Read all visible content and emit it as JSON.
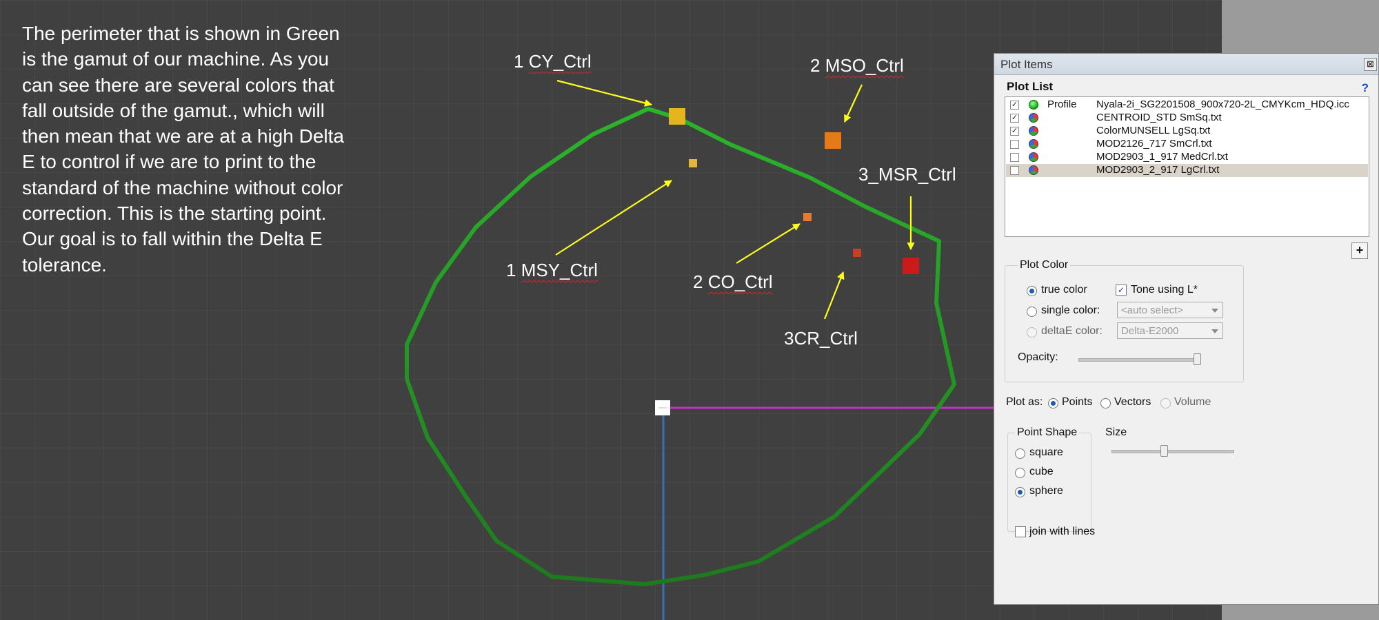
{
  "note": {
    "text": "The perimeter that is shown in Green is the gamut of our machine. As you can see there are several colors that fall outside of the gamut., which will then mean that we are at a high Delta E to control if we are to print to the standard of the machine without color correction. This is the starting point. Our goal is to fall within the Delta E tolerance."
  },
  "callouts": {
    "cy_ctrl": {
      "num": "1 ",
      "word": "CY_Ctrl"
    },
    "mso_ctrl": {
      "num": "2 ",
      "word": "MSO_Ctrl"
    },
    "msr_ctrl": {
      "text": "3_MSR_Ctrl"
    },
    "msy_ctrl": {
      "num": "1 ",
      "word": "MSY_Ctrl"
    },
    "co_ctrl": {
      "num": "2 ",
      "word": "CO_Ctrl"
    },
    "cr_ctrl": {
      "text": "3CR_Ctrl"
    }
  },
  "colors": {
    "gamut": "#23a523",
    "arrow": "#ffff1a",
    "axis_yellow": "#d8d81e",
    "axis_cyan": "#2fd6dc",
    "axis_magenta": "#c52fc5",
    "axis_blue": "#3a6fb0"
  },
  "panel": {
    "title": "Plot Items",
    "close_glyph": "⊠",
    "plot_list_label": "Plot List",
    "help_glyph": "?",
    "check_glyph": "✓",
    "items": [
      {
        "checked": true,
        "icon": "green-sphere-icon",
        "tag": "Profile",
        "name": "Nyala-2i_SG2201508_900x720-2L_CMYKcm_HDQ.icc",
        "selected": false
      },
      {
        "checked": true,
        "icon": "multicolor-sphere-icon",
        "tag": "",
        "name": "CENTROID_STD SmSq.txt",
        "selected": false
      },
      {
        "checked": true,
        "icon": "multicolor-sphere-icon",
        "tag": "",
        "name": "ColorMUNSELL LgSq.txt",
        "selected": false
      },
      {
        "checked": false,
        "icon": "multicolor-sphere-icon",
        "tag": "",
        "name": "MOD2126_717 SmCrl.txt",
        "selected": false
      },
      {
        "checked": false,
        "icon": "multicolor-sphere-icon",
        "tag": "",
        "name": "MOD2903_1_917 MedCrl.txt",
        "selected": false
      },
      {
        "checked": false,
        "icon": "multicolor-sphere-icon",
        "tag": "",
        "name": "MOD2903_2_917 LgCrl.txt",
        "selected": true
      }
    ],
    "add_glyph": "+",
    "plot_color": {
      "label": "Plot Color",
      "true_color": "true color",
      "tone_using": "Tone using L*",
      "single_color": "single color:",
      "single_value": "<auto select>",
      "deltae_color": "deltaE color:",
      "deltae_value": "Delta-E2000",
      "opacity": "Opacity:"
    },
    "plot_as": {
      "label": "Plot as:",
      "points": "Points",
      "vectors": "Vectors",
      "volume": "Volume"
    },
    "point_shape": {
      "label": "Point Shape",
      "square": "square",
      "cube": "cube",
      "sphere": "sphere"
    },
    "size_label": "Size",
    "size_value": 0.43,
    "opacity_value": 1.0,
    "join_with_lines": "join with lines"
  }
}
